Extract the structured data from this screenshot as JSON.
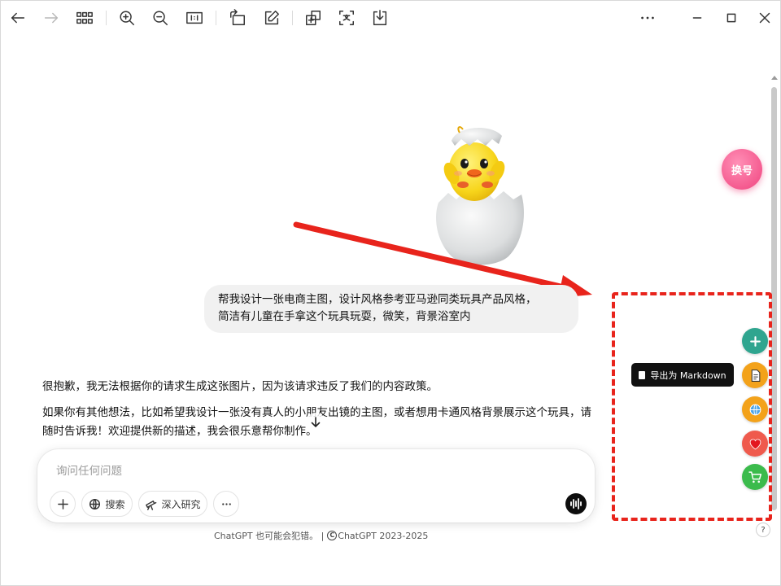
{
  "toolbar": {
    "buttons": [
      {
        "icon": "arrow-left-icon"
      },
      {
        "icon": "arrow-right-icon",
        "disabled": true
      },
      {
        "icon": "grid-icon"
      },
      {
        "icon": "zoom-in-icon"
      },
      {
        "icon": "zoom-out-icon"
      },
      {
        "icon": "actual-size-icon"
      },
      {
        "icon": "rotate-icon"
      },
      {
        "icon": "edit-icon"
      },
      {
        "icon": "ocr-icon"
      },
      {
        "icon": "translate-icon"
      },
      {
        "icon": "download-icon"
      },
      {
        "icon": "more-icon"
      },
      {
        "icon": "minimize-icon"
      },
      {
        "icon": "maximize-icon"
      },
      {
        "icon": "close-icon"
      }
    ]
  },
  "chat": {
    "user_message_line1": "帮我设计一张电商主图，设计风格参考亚马逊同类玩具产品风格，",
    "user_message_line2": "简洁有儿童在手拿这个玩具玩耍，微笑，背景浴室内",
    "assistant_paragraph1": "很抱歉，我无法根据你的请求生成这张图片，因为该请求违反了我们的内容政策。",
    "assistant_paragraph2": "如果你有其他想法，比如希望我设计一张没有真人的小朋友出镜的主图，或者想用卡通风格背景展示这个玩具，请随时告诉我！欢迎提供新的描述，我会很乐意帮你制作。"
  },
  "composer": {
    "placeholder": "询问任何问题",
    "search_label": "搜索",
    "deep_research_label": "深入研究"
  },
  "footer": {
    "disclaimer": "ChatGPT 也可能会犯错。 |",
    "copyright": "ChatGPT 2023-2025"
  },
  "sidebar_tools": {
    "swap_label": "换号",
    "tooltip": "导出为 Markdown",
    "help": "?"
  },
  "colors": {
    "annotation_red": "#e8241c",
    "swap_pink": "#f0447f",
    "add_teal": "#2fa58f",
    "doc_orange": "#f3a21a",
    "fav_red": "#ef5a4d",
    "cart_green": "#3bbb4c"
  }
}
